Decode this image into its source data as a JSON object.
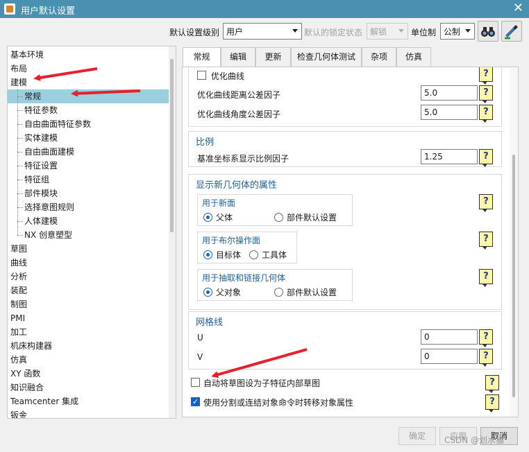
{
  "window": {
    "title": "用户默认设置",
    "close_glyph": "✕"
  },
  "toolbar": {
    "level_label": "默认设置级别",
    "level_value": "用户",
    "lock_label": "默认的锁定状态",
    "lock_value": "解锁",
    "unit_label": "单位制",
    "unit_value": "公制",
    "icon_1": "binoculars-icon",
    "icon_2": "manage-settings-icon"
  },
  "tree": {
    "top_items": [
      "基本环境",
      "布局",
      "建模"
    ],
    "children": [
      "常规",
      "特征参数",
      "自由曲面特征参数",
      "实体建模",
      "自由曲面建模",
      "特征设置",
      "特征组",
      "部件模块",
      "选择意图规则",
      "人体建模",
      "NX 创意塑型"
    ],
    "selected": "常规",
    "bottom_items": [
      "草图",
      "曲线",
      "分析",
      "装配",
      "制图",
      "PMI",
      "加工",
      "机床构建器",
      "仿真",
      "XY 函数",
      "知识融合",
      "Teamcenter 集成",
      "钣金"
    ]
  },
  "tabs": [
    "常规",
    "编辑",
    "更新",
    "检查几何体测试",
    "杂项",
    "仿真"
  ],
  "active_tab": "常规",
  "panel": {
    "group1": {
      "optimize_curve_label": "优化曲线",
      "dist_label": "优化曲线距离公差因子",
      "dist_value": "5.0",
      "angle_label": "优化曲线角度公差因子",
      "angle_value": "5.0"
    },
    "scale": {
      "title": "比例",
      "factor_label": "基准坐标系显示比例因子",
      "factor_value": "1.25"
    },
    "new_geom": {
      "title": "显示新几何体的属性",
      "new_face": {
        "title": "用于新面",
        "opt1": "父体",
        "opt2": "部件默认设置"
      },
      "boolean": {
        "title": "用于布尔操作面",
        "opt1": "目标体",
        "opt2": "工具体"
      },
      "extract": {
        "title": "用于抽取和链接几何体",
        "opt1": "父对象",
        "opt2": "部件默认设置"
      }
    },
    "grid": {
      "title": "网格线",
      "u_label": "U",
      "u_value": "0",
      "v_label": "V",
      "v_value": "0"
    },
    "check_sketch": "自动将草图设为子特征内部草图",
    "check_split": "使用分割或连结对象命令时转移对象属性",
    "help_glyph": "?"
  },
  "buttons": {
    "ok": "确定",
    "apply": "应用",
    "cancel": "取消"
  },
  "watermark": "CSDN @划水猫",
  "colors": {
    "titlebar": "#4a90b0",
    "selection": "#9bcfe0",
    "accent": "#1e5f9a",
    "annotation": "#e8202a"
  }
}
